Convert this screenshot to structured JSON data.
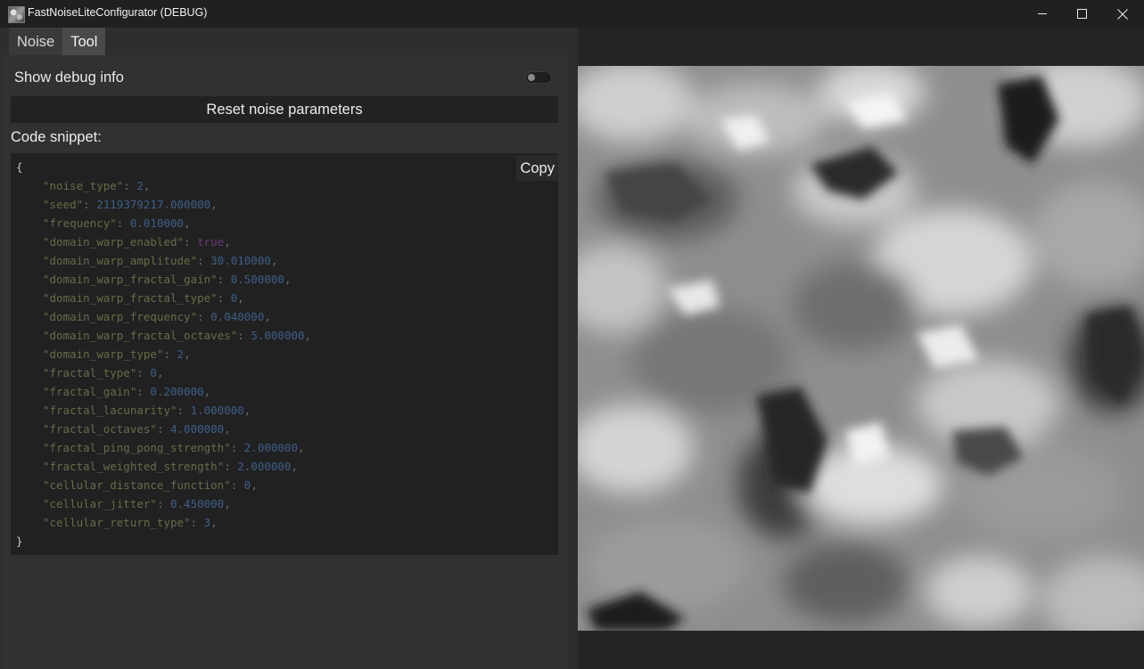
{
  "window": {
    "title": "FastNoiseLiteConfigurator (DEBUG)",
    "icon": "app-icon",
    "controls": [
      "minimize-icon",
      "maximize-icon",
      "close-icon"
    ]
  },
  "tabs": [
    {
      "label": "Noise",
      "active": false
    },
    {
      "label": "Tool",
      "active": true
    }
  ],
  "tool": {
    "debug_label": "Show debug info",
    "debug_enabled": false,
    "reset_label": "Reset noise parameters",
    "snippet_heading": "Code snippet:",
    "copy_label": "Copy",
    "open_brace": "{",
    "close_brace": "}",
    "params": [
      {
        "key": "\"noise_type\"",
        "value": "2",
        "kind": "number"
      },
      {
        "key": "\"seed\"",
        "value": "2119379217.000000",
        "kind": "number"
      },
      {
        "key": "\"frequency\"",
        "value": "0.010000",
        "kind": "number"
      },
      {
        "key": "\"domain_warp_enabled\"",
        "value": "true",
        "kind": "bool"
      },
      {
        "key": "\"domain_warp_amplitude\"",
        "value": "30.010000",
        "kind": "number"
      },
      {
        "key": "\"domain_warp_fractal_gain\"",
        "value": "0.500000",
        "kind": "number"
      },
      {
        "key": "\"domain_warp_fractal_type\"",
        "value": "0",
        "kind": "number"
      },
      {
        "key": "\"domain_warp_frequency\"",
        "value": "0.040000",
        "kind": "number"
      },
      {
        "key": "\"domain_warp_fractal_octaves\"",
        "value": "5.000000",
        "kind": "number"
      },
      {
        "key": "\"domain_warp_type\"",
        "value": "2",
        "kind": "number"
      },
      {
        "key": "\"fractal_type\"",
        "value": "0",
        "kind": "number"
      },
      {
        "key": "\"fractal_gain\"",
        "value": "0.200000",
        "kind": "number"
      },
      {
        "key": "\"fractal_lacunarity\"",
        "value": "1.000000",
        "kind": "number"
      },
      {
        "key": "\"fractal_octaves\"",
        "value": "4.000000",
        "kind": "number"
      },
      {
        "key": "\"fractal_ping_pong_strength\"",
        "value": "2.000000",
        "kind": "number"
      },
      {
        "key": "\"fractal_weighted_strength\"",
        "value": "2.000000",
        "kind": "number"
      },
      {
        "key": "\"cellular_distance_function\"",
        "value": "0",
        "kind": "number"
      },
      {
        "key": "\"cellular_jitter\"",
        "value": "0.450000",
        "kind": "number"
      },
      {
        "key": "\"cellular_return_type\"",
        "value": "3",
        "kind": "number"
      }
    ]
  },
  "colors": {
    "background": "#202020",
    "panel": "#313131",
    "code_key": "#6a6a4a",
    "code_number": "#3e5f88",
    "code_bool": "#6b3a7a"
  }
}
